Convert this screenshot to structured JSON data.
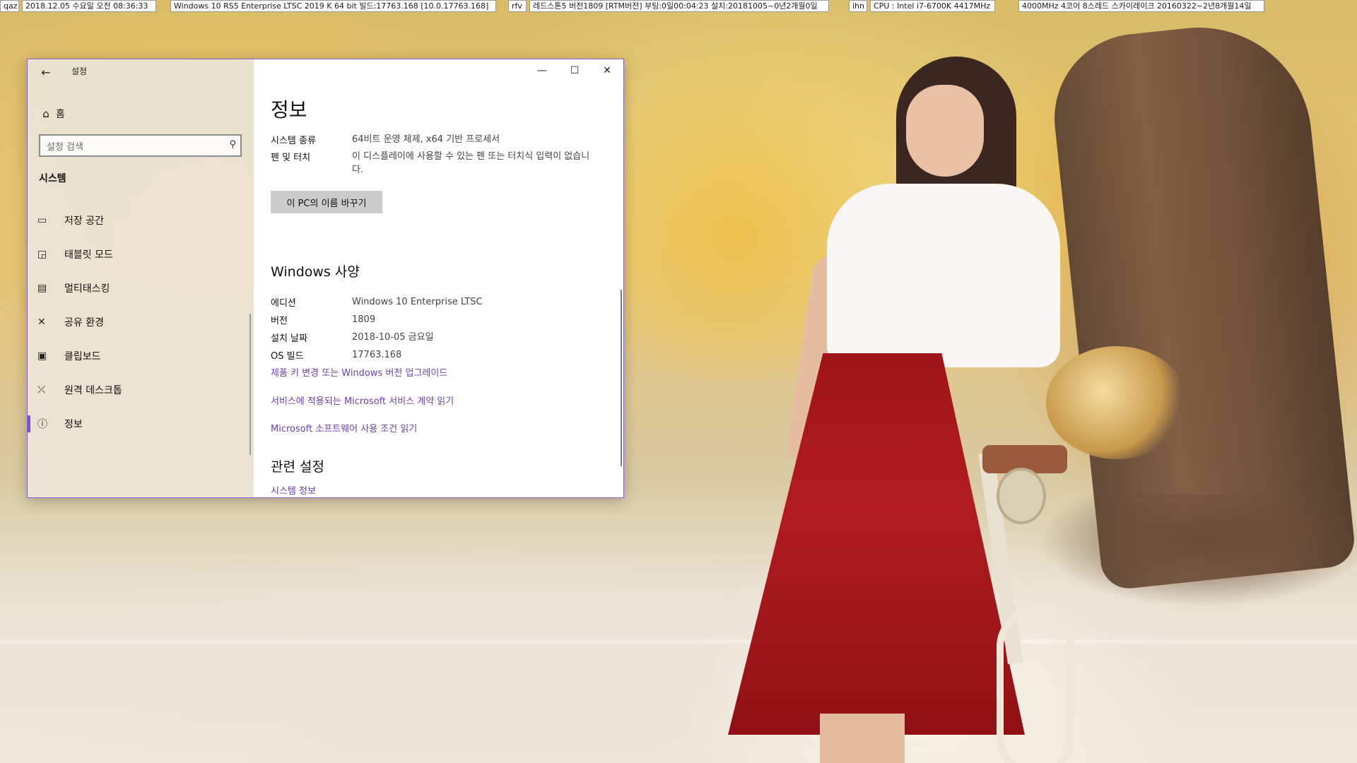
{
  "infobar": {
    "cells": [
      "qaz",
      "2018.12.05 수요일 오전 08:36:33",
      "Windows 10 RS5 Enterprise LTSC 2019 K 64 bit 빌드:17763.168 [10.0.17763.168]",
      "rfv",
      "레드스톤5 버전1809 [RTM버전] 부팅:0일00:04:23 설치:20181005~0년2개월0일",
      "ihn",
      "CPU : Intel i7-6700K 4417MHz",
      "4000MHz 4코어 8스레드 스카이레이크 20160322~2년8개월14일"
    ]
  },
  "window": {
    "app_title": "설정",
    "back_icon": "back-arrow-icon",
    "controls": {
      "minimize": "—",
      "maximize": "☐",
      "close": "✕"
    },
    "nav": {
      "home_label": "홈",
      "search_placeholder": "설정 검색",
      "section_title": "시스템",
      "items": [
        {
          "label": "저장 공간",
          "icon": "storage-icon",
          "glyph": "▭"
        },
        {
          "label": "태블릿 모드",
          "icon": "tablet-mode-icon",
          "glyph": "◲"
        },
        {
          "label": "멀티태스킹",
          "icon": "multitasking-icon",
          "glyph": "▤"
        },
        {
          "label": "공유 환경",
          "icon": "shared-experiences-icon",
          "glyph": "✕"
        },
        {
          "label": "클립보드",
          "icon": "clipboard-icon",
          "glyph": "▣"
        },
        {
          "label": "원격 데스크톱",
          "icon": "remote-desktop-icon",
          "glyph": "⤫"
        },
        {
          "label": "정보",
          "icon": "info-icon",
          "glyph": "ⓘ",
          "active": true
        }
      ]
    },
    "content": {
      "title": "정보",
      "system_type_label": "시스템 종류",
      "system_type_value": "64비트 운영 체제, x64 기반 프로세서",
      "pen_touch_label": "펜 및 터치",
      "pen_touch_value": "이 디스플레이에 사용할 수 있는 펜 또는 터치식 입력이 없습니다.",
      "rename_button": "이 PC의 이름 바꾸기",
      "windows_spec_heading": "Windows 사양",
      "edition_label": "에디션",
      "edition_value": "Windows 10 Enterprise LTSC",
      "version_label": "버전",
      "version_value": "1809",
      "install_date_label": "설치 날짜",
      "install_date_value": "2018-10-05 금요일",
      "os_build_label": "OS 빌드",
      "os_build_value": "17763.168",
      "link_upgrade": "제품 키 변경 또는 Windows 버전 업그레이드",
      "link_service_agreement": "서비스에 적용되는 Microsoft 서비스 계약 읽기",
      "link_license_terms": "Microsoft 소프트웨어 사용 조건 읽기",
      "related_heading": "관련 설정",
      "link_system_info": "시스템 정보"
    }
  },
  "colors": {
    "accent": "#7a52c7",
    "link": "#6a3fba",
    "window_border": "#8a5fd0"
  }
}
